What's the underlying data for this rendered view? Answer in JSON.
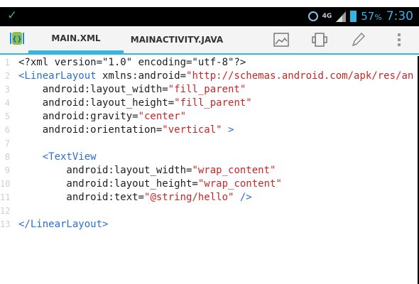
{
  "status_bar": {
    "network_type": "4G",
    "battery_percent": "57",
    "battery_percent_sign": "%",
    "time": "7:30",
    "icons": [
      "check-icon",
      "alarm-icon",
      "signal-icon",
      "battery-icon"
    ]
  },
  "action_bar": {
    "tabs": [
      {
        "label": "MAIN.XML",
        "active": true
      },
      {
        "label": "MAINACTIVITY.JAVA",
        "active": false
      }
    ],
    "actions": [
      "image-preview-icon",
      "layout-icon",
      "edit-pencil-icon",
      "overflow-menu-icon"
    ]
  },
  "editor": {
    "lines": [
      {
        "n": "1",
        "segs": [
          [
            "txt",
            "<?xml version=\"1.0\" encoding=\"utf-8\"?>"
          ]
        ]
      },
      {
        "n": "2",
        "segs": [
          [
            "tag",
            "<LinearLayout"
          ],
          [
            "txt",
            " xmlns:android="
          ],
          [
            "str",
            "\"http://schemas.android.com/apk/res/an"
          ]
        ]
      },
      {
        "n": "3",
        "segs": [
          [
            "txt",
            "    android:layout_width="
          ],
          [
            "str",
            "\"fill_parent\""
          ]
        ]
      },
      {
        "n": "4",
        "segs": [
          [
            "txt",
            "    android:layout_height="
          ],
          [
            "str",
            "\"fill_parent\""
          ]
        ]
      },
      {
        "n": "5",
        "segs": [
          [
            "txt",
            "    android:gravity="
          ],
          [
            "str",
            "\"center\""
          ]
        ]
      },
      {
        "n": "6",
        "segs": [
          [
            "txt",
            "    android:orientation="
          ],
          [
            "str",
            "\"vertical\""
          ],
          [
            "tag",
            " >"
          ]
        ]
      },
      {
        "n": "7",
        "segs": []
      },
      {
        "n": "8",
        "segs": [
          [
            "tag",
            "    <TextView"
          ]
        ]
      },
      {
        "n": "9",
        "segs": [
          [
            "txt",
            "        android:layout_width="
          ],
          [
            "str",
            "\"wrap_content\""
          ]
        ]
      },
      {
        "n": "10",
        "segs": [
          [
            "txt",
            "        android:layout_height="
          ],
          [
            "str",
            "\"wrap_content\""
          ]
        ]
      },
      {
        "n": "11",
        "segs": [
          [
            "txt",
            "        android:text="
          ],
          [
            "str",
            "\"@string/hello\""
          ],
          [
            "tag",
            " />"
          ]
        ]
      },
      {
        "n": "12",
        "segs": []
      },
      {
        "n": "13",
        "segs": [
          [
            "tag",
            "</LinearLayout>"
          ]
        ]
      }
    ]
  }
}
